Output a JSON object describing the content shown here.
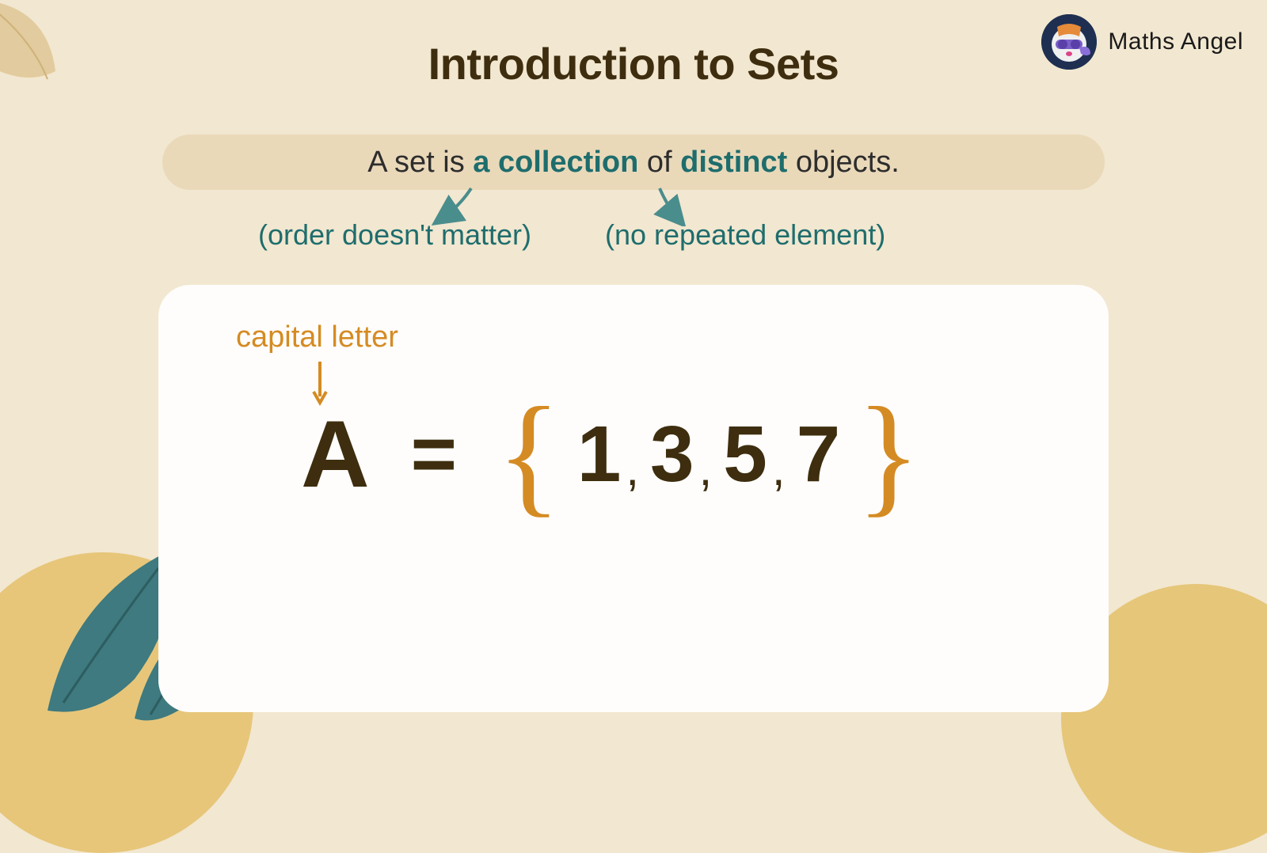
{
  "brand": {
    "name": "Maths Angel"
  },
  "title": "Introduction to Sets",
  "definition": {
    "pre": "A set is ",
    "hl1": "a collection",
    "mid": " of ",
    "hl2": "distinct",
    "post": " objects."
  },
  "annotations": {
    "collection": "(order doesn't matter)",
    "distinct": "(no repeated element)"
  },
  "example": {
    "capitalLetterLabel": "capital letter",
    "setName": "A",
    "equals": "=",
    "openBrace": "{",
    "closeBrace": "}",
    "elements": [
      "1",
      "3",
      "5",
      "7"
    ],
    "comma": ","
  }
}
